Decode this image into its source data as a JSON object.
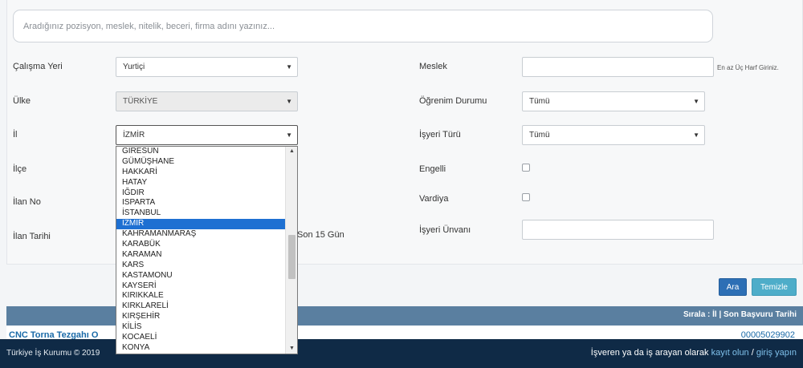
{
  "search": {
    "placeholder": "Aradığınız pozisyon, meslek, nitelik, beceri, firma adını yazınız..."
  },
  "filters": {
    "calisma_yeri": {
      "label": "Çalışma Yeri",
      "value": "Yurtiçi"
    },
    "ulke": {
      "label": "Ülke",
      "value": "TÜRKİYE"
    },
    "il": {
      "label": "İl",
      "value": "İZMİR"
    },
    "ilce": {
      "label": "İlçe"
    },
    "ilan_no": {
      "label": "İlan No"
    },
    "ilan_tarihi": {
      "label": "İlan Tarihi",
      "value_tail": "Son 15 Gün"
    },
    "meslek": {
      "label": "Meslek",
      "hint": "En az Üç Harf Giriniz."
    },
    "ogrenim": {
      "label": "Öğrenim Durumu",
      "value": "Tümü"
    },
    "isyeri_turu": {
      "label": "İşyeri Türü",
      "value": "Tümü"
    },
    "engelli": {
      "label": "Engelli"
    },
    "vardiya": {
      "label": "Vardiya"
    },
    "isyeri_unvani": {
      "label": "İşyeri Ünvanı"
    }
  },
  "il_dropdown": {
    "items": [
      "GİRESUN",
      "GÜMÜŞHANE",
      "HAKKARİ",
      "HATAY",
      "IĞDIR",
      "ISPARTA",
      "İSTANBUL",
      "İZMİR",
      "KAHRAMANMARAŞ",
      "KARABÜK",
      "KARAMAN",
      "KARS",
      "KASTAMONU",
      "KAYSERİ",
      "KIRIKKALE",
      "KIRKLARELİ",
      "KIRŞEHİR",
      "KİLİS",
      "KOCAELİ",
      "KONYA"
    ],
    "selected": "İZMİR"
  },
  "buttons": {
    "ara": "Ara",
    "temizle": "Temizle"
  },
  "sort": {
    "text": "Sırala : İl | Son Başvuru Tarihi"
  },
  "result": {
    "title": "CNC Torna Tezgahı O",
    "number": "00005029902"
  },
  "footer": {
    "copyright": "Türkiye İş Kurumu © 2019",
    "prompt": "İşveren ya da iş arayan olarak ",
    "register": "kayıt olun",
    "separator": " / ",
    "login": "giriş yapın"
  }
}
